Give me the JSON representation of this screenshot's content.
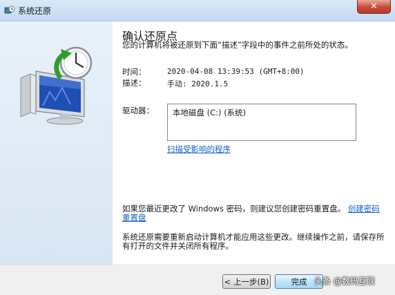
{
  "window": {
    "title": "系统还原",
    "close_glyph": "✕"
  },
  "sidebar": {
    "illustration": "system-restore-clock-monitor"
  },
  "content": {
    "heading": "确认还原点",
    "subtitle": "您的计算机将被还原到下面“描述”字段中的事件之前所处的状态。",
    "time_label": "时间：",
    "time_value": "2020-04-08 13:39:53 (GMT+8:00)",
    "desc_label": "描述：",
    "desc_value": "手动: 2020.1.5",
    "drives_label": "驱动器：",
    "drives": [
      "本地磁盘 (C:) (系统)"
    ],
    "scan_link": "扫描受影响的程序",
    "password_text": "如果您最近更改了 Windows 密码，则建议您创建密码重置盘。",
    "password_link": "创建密码重置盘",
    "restart_text": "系统还原需要重新启动计算机才能应用这些更改。继续操作之前，请保存所有打开的文件并关闭所有程序。"
  },
  "footer": {
    "back_label": "< 上一步(B)",
    "finish_label": "完成",
    "watermark": "头条 @数码互联"
  }
}
